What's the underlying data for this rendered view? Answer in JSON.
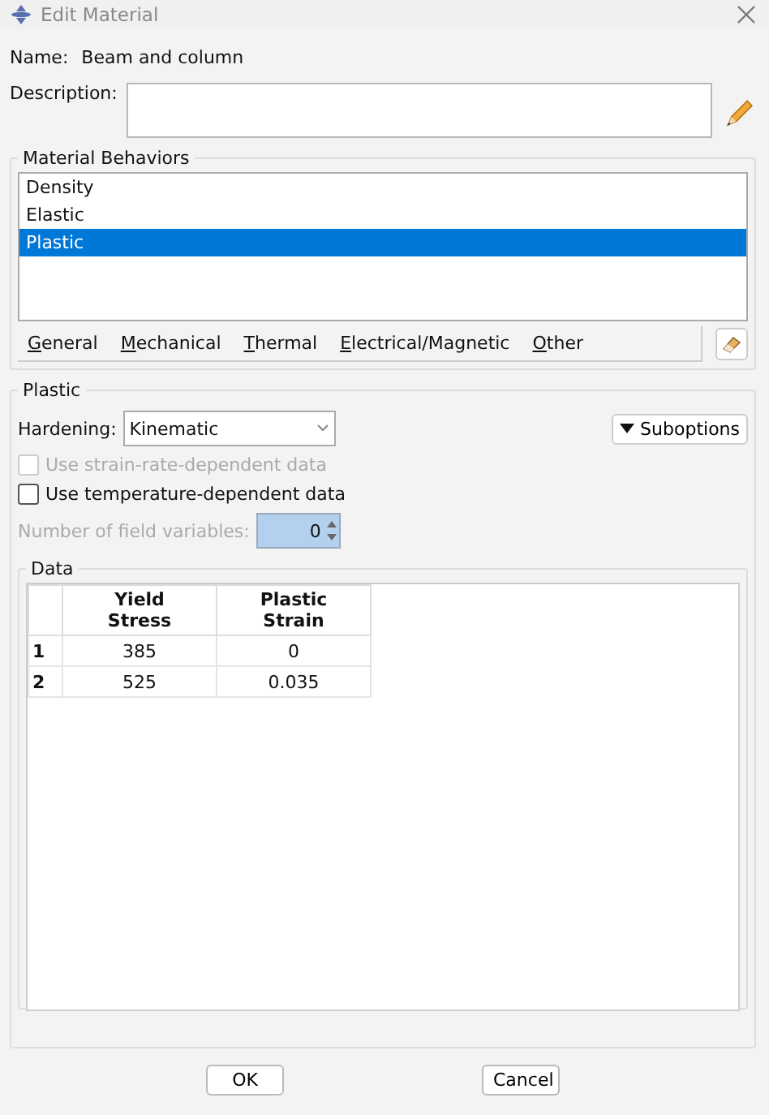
{
  "window": {
    "title": "Edit Material"
  },
  "name": {
    "label": "Name:",
    "value": "Beam and column"
  },
  "description": {
    "label": "Description:"
  },
  "behaviors": {
    "title": "Material Behaviors",
    "items": [
      {
        "label": "Density",
        "selected": false
      },
      {
        "label": "Elastic",
        "selected": false
      },
      {
        "label": "Plastic",
        "selected": true
      }
    ],
    "menu": [
      "General",
      "Mechanical",
      "Thermal",
      "Electrical/Magnetic",
      "Other"
    ]
  },
  "plastic": {
    "title": "Plastic",
    "hardening_label": "Hardening:",
    "hardening": "Kinematic",
    "suboptions": "Suboptions",
    "options": [
      {
        "label": "Use strain-rate-dependent data",
        "checked": false,
        "disabled": true
      },
      {
        "label": "Use temperature-dependent data",
        "checked": false,
        "disabled": false
      }
    ],
    "field_vars": {
      "label": "Number of field variables:",
      "value": "0",
      "disabled": true
    },
    "data": {
      "title": "Data",
      "columns": [
        "Yield\nStress",
        "Plastic\nStrain"
      ],
      "rows": [
        {
          "index": "1",
          "cells": [
            "385",
            "0"
          ]
        },
        {
          "index": "2",
          "cells": [
            "525",
            "0.035"
          ]
        }
      ]
    }
  },
  "buttons": [
    "OK",
    "Cancel"
  ]
}
